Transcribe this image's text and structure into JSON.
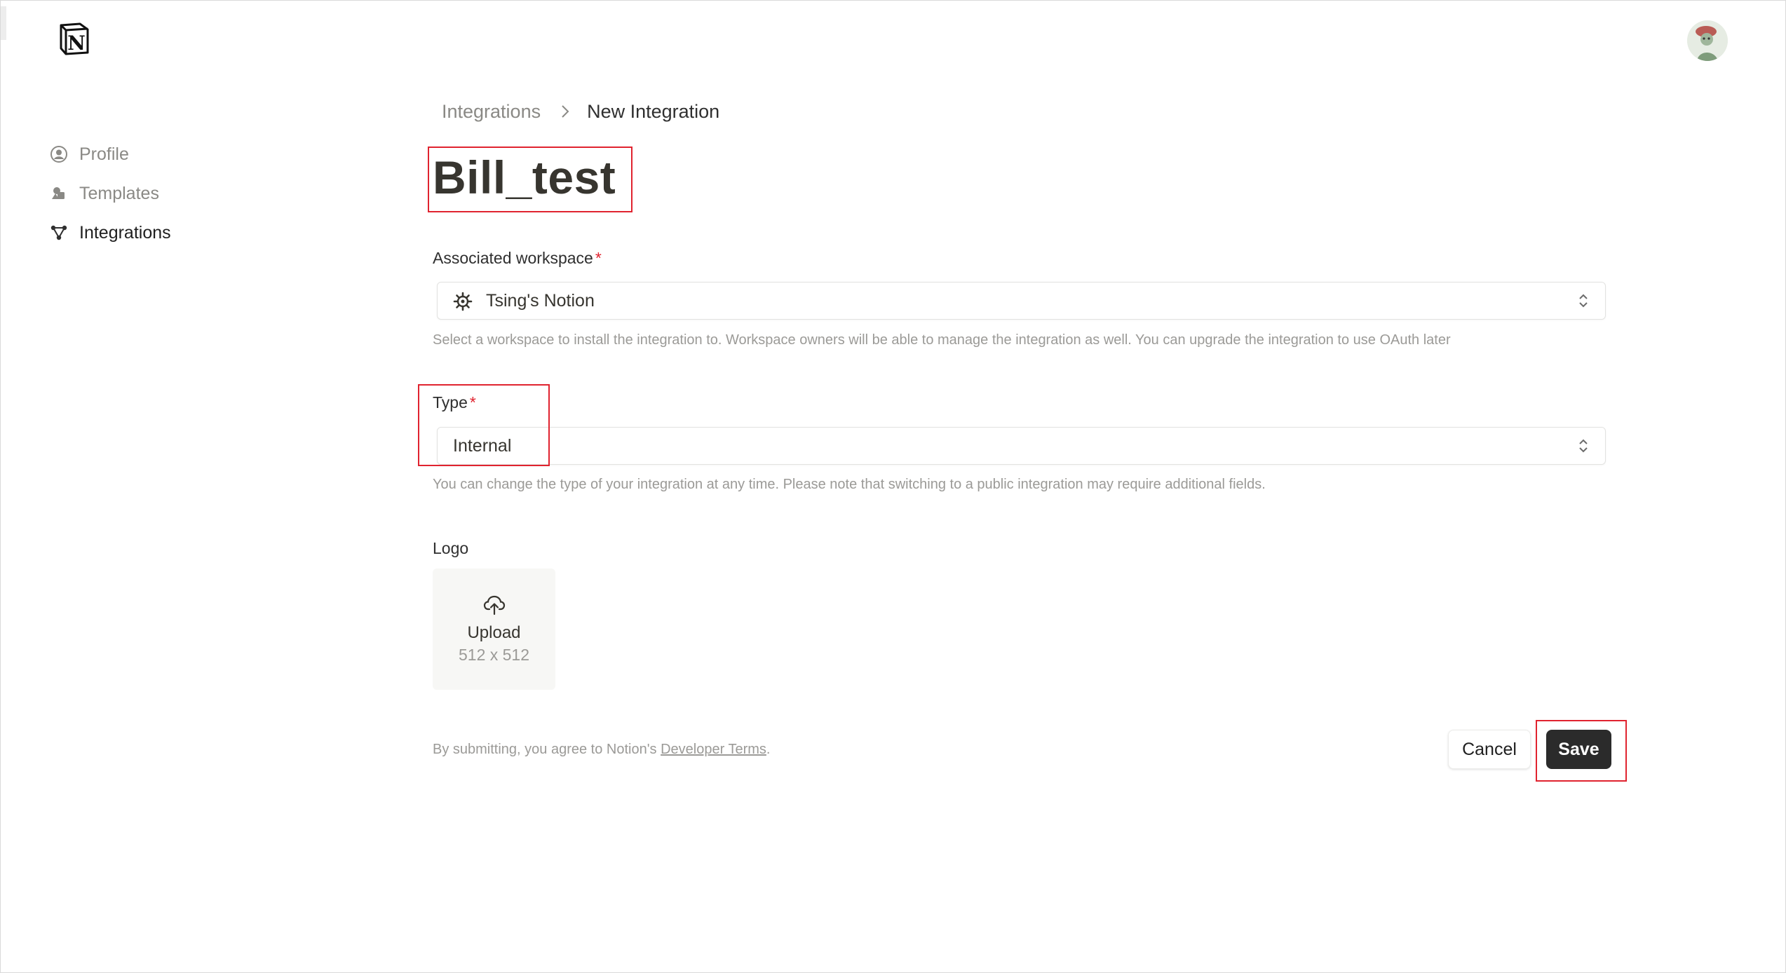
{
  "sidebar": {
    "items": [
      {
        "label": "Profile",
        "icon": "profile-icon",
        "active": false
      },
      {
        "label": "Templates",
        "icon": "templates-icon",
        "active": false
      },
      {
        "label": "Integrations",
        "icon": "integrations-icon",
        "active": true
      }
    ]
  },
  "breadcrumb": {
    "parent": "Integrations",
    "current": "New Integration"
  },
  "integration": {
    "name": "Bill_test"
  },
  "workspace_field": {
    "label": "Associated workspace",
    "required_mark": "*",
    "value": "Tsing's Notion",
    "icon": "workspace-icon",
    "help": "Select a workspace to install the integration to. Workspace owners will be able to manage the integration as well. You can upgrade the integration to use OAuth later"
  },
  "type_field": {
    "label": "Type",
    "required_mark": "*",
    "value": "Internal",
    "help": "You can change the type of your integration at any time. Please note that switching to a public integration may require additional fields."
  },
  "logo_field": {
    "label": "Logo",
    "upload_label": "Upload",
    "size_hint": "512 x 512",
    "icon": "cloud-upload-icon"
  },
  "footer": {
    "terms_prefix": "By submitting, you agree to Notion's ",
    "terms_link": "Developer Terms",
    "terms_suffix": ".",
    "cancel_label": "Cancel",
    "save_label": "Save"
  },
  "colors": {
    "highlight": "#e0232f",
    "save_bg": "#2b2b2b",
    "muted_text": "#9b9a97"
  }
}
